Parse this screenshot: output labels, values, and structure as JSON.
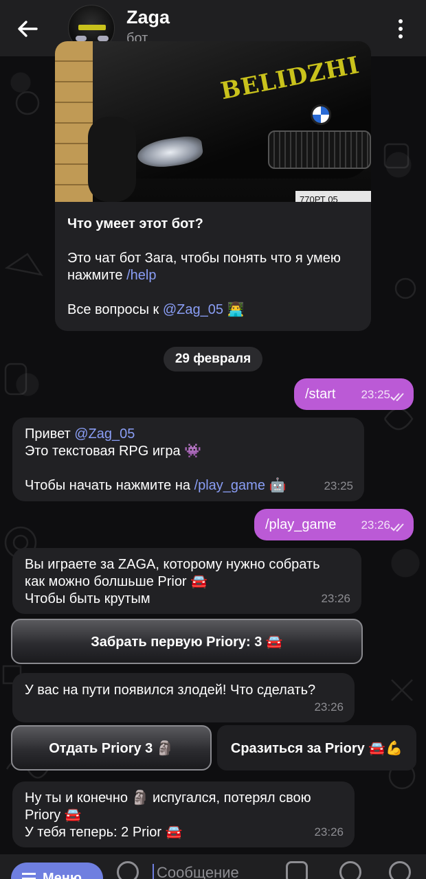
{
  "header": {
    "title": "Zaga",
    "subtitle": "бот"
  },
  "intro": {
    "photo_plate_text": "BELIDZHI",
    "photo_license": "770РТ 05",
    "heading": "Что умеет этот бот?",
    "line1": "Это чат бот Зага, чтобы понять что я умею нажмите ",
    "help_cmd": "/help",
    "questions_prefix": "Все вопросы к ",
    "mention": "@Zag_05",
    "emoji": "👨‍💻"
  },
  "date_chip": "29 февраля",
  "messages": [
    {
      "dir": "out",
      "text": "/start",
      "time": "23:25"
    },
    {
      "dir": "in",
      "greeting": "Привет ",
      "mention": "@Zag_05",
      "line2": "Это текстовая RPG игра 👾",
      "line3_prefix": "Чтобы начать нажмите на ",
      "cmd": "/play_game",
      "line3_emoji": " 🤖",
      "time": "23:25"
    },
    {
      "dir": "out",
      "text": "/play_game",
      "time": "23:26"
    },
    {
      "dir": "in",
      "line1": "Вы играете за ZAGA, которому нужно собрать",
      "line2": "как можно болшьше Prior 🚘",
      "line3": "Чтобы быть крутым",
      "time": "23:26"
    },
    {
      "dir": "in",
      "text": "У вас на пути появился злодей! Что сделать?",
      "time": "23:26"
    },
    {
      "dir": "in",
      "line1": "Ну ты и конечно 🗿 испугался, потерял свою",
      "line2": "Priory 🚘",
      "line3": "У тебя теперь: 2 Prior 🚘",
      "time": "23:26"
    }
  ],
  "buttons": {
    "take_first": "Забрать первую Priory: 3 🚘",
    "give": "Отдать Priory 3 🗿",
    "fight": "Сразиться за Priory 🚘💪"
  },
  "composer": {
    "menu_label": "Меню",
    "placeholder": "Сообщение"
  },
  "colors": {
    "outgoing_bubble": "#bb5ad6",
    "incoming_bubble": "#212124",
    "link": "#8a9ef5",
    "menu_button": "#6f7fe0"
  }
}
